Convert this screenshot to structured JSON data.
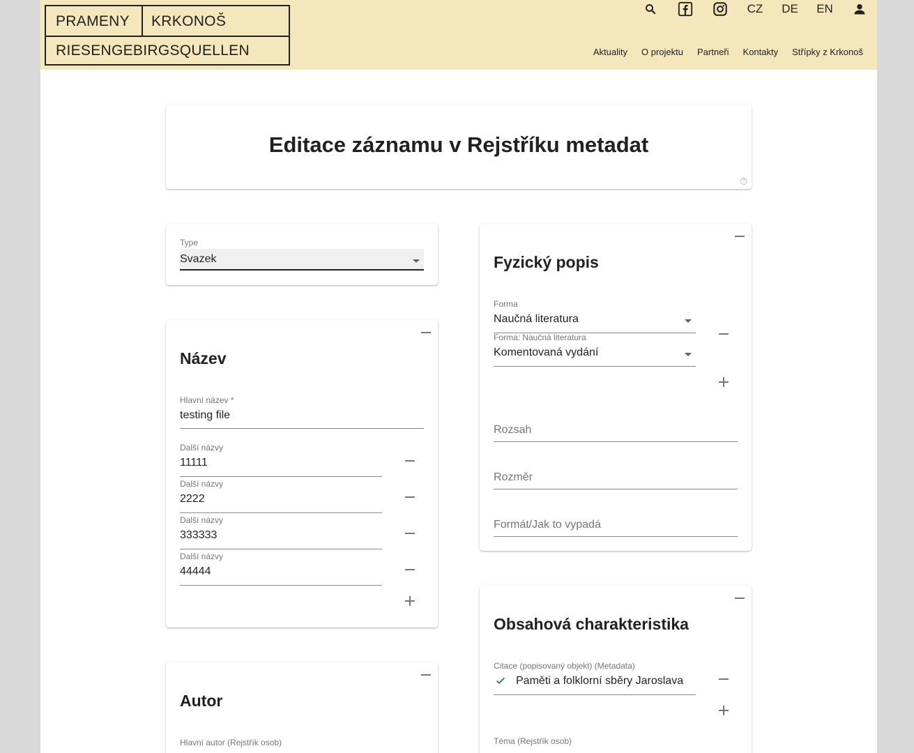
{
  "header": {
    "logo": {
      "word1": "PRAMENY",
      "word2": "KRKONOŠ",
      "word3": "RIESENGEBIRGSQUELLEN"
    },
    "icons": {
      "search": "search-icon",
      "facebook": "facebook-icon",
      "instagram": "instagram-icon",
      "user": "user-icon"
    },
    "languages": [
      "CZ",
      "DE",
      "EN"
    ],
    "nav": [
      "Aktuality",
      "O projektu",
      "Partneři",
      "Kontakty",
      "Střípky z Krkonoš"
    ]
  },
  "page_title": "Editace záznamu v Rejstříku metadat",
  "type_select": {
    "label": "Type",
    "value": "Svazek"
  },
  "nazev": {
    "title": "Název",
    "main_label": "Hlavní název *",
    "main_value": "testing file",
    "other_label": "Další názvy",
    "others": [
      "11111",
      "2222",
      "333333",
      "44444"
    ]
  },
  "autor": {
    "title": "Autor",
    "main_label": "Hlavní autor (Rejstřík osob)"
  },
  "fyzicky": {
    "title": "Fyzický popis",
    "forma_label": "Forma",
    "forma_value": "Naučná literatura",
    "subforma_label": "Forma: Naučná literatura",
    "subforma_value": "Komentovaná vydání",
    "rozsah_placeholder": "Rozsah",
    "rozmer_placeholder": "Rozměr",
    "format_placeholder": "Formát/Jak to vypadá"
  },
  "obsahova": {
    "title": "Obsahová charakteristika",
    "citace_label": "Citace (popisovaný objekt) (Metadata)",
    "citace_value": "Paměti a folklorní sběry Jaroslava",
    "tema_label": "Téma (Rejstřík osob)"
  },
  "colors": {
    "header_bg": "#f4e7bb",
    "check": "#2e7d32"
  }
}
